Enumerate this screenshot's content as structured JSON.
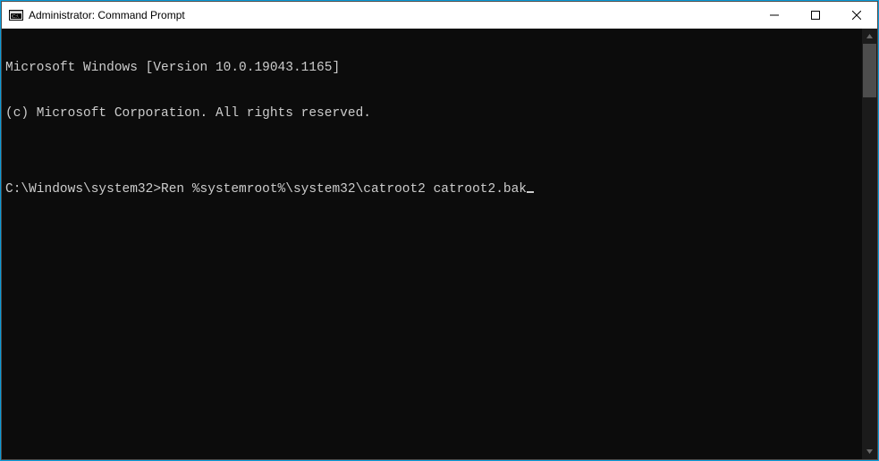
{
  "window": {
    "title": "Administrator: Command Prompt"
  },
  "console": {
    "lines": [
      "Microsoft Windows [Version 10.0.19043.1165]",
      "(c) Microsoft Corporation. All rights reserved.",
      ""
    ],
    "prompt": "C:\\Windows\\system32>",
    "command": "Ren %systemroot%\\system32\\catroot2 catroot2.bak"
  }
}
